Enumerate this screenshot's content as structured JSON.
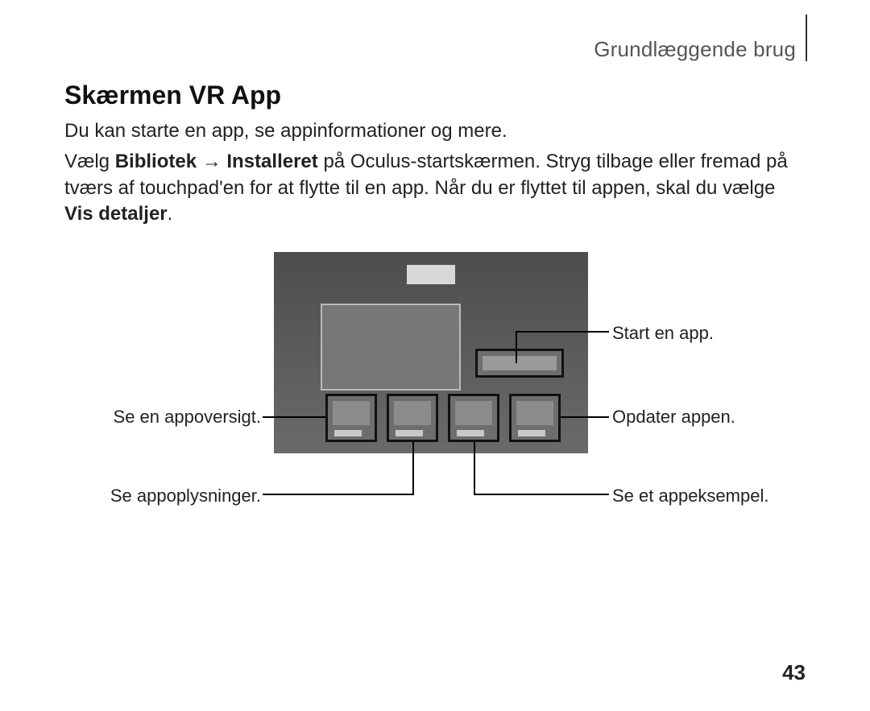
{
  "header": {
    "section_label": "Grundlæggende brug"
  },
  "title": "Skærmen VR App",
  "intro": "Du kan starte en app, se appinformationer og mere.",
  "body": {
    "pre": "Vælg ",
    "bold1": "Bibliotek",
    "arrow": " → ",
    "bold2": "Installeret",
    "post1": " på Oculus-startskærmen. Stryg tilbage eller fremad på tværs af touchpad'en for at flytte til en app. Når du er flyttet til appen, skal du vælge ",
    "bold3": "Vis detaljer",
    "post2": "."
  },
  "callouts": {
    "start_app": "Start en app.",
    "overview": "Se en appoversigt.",
    "update": "Opdater appen.",
    "app_info": "Se appoplysninger.",
    "example": "Se et appeksempel."
  },
  "page_number": "43"
}
